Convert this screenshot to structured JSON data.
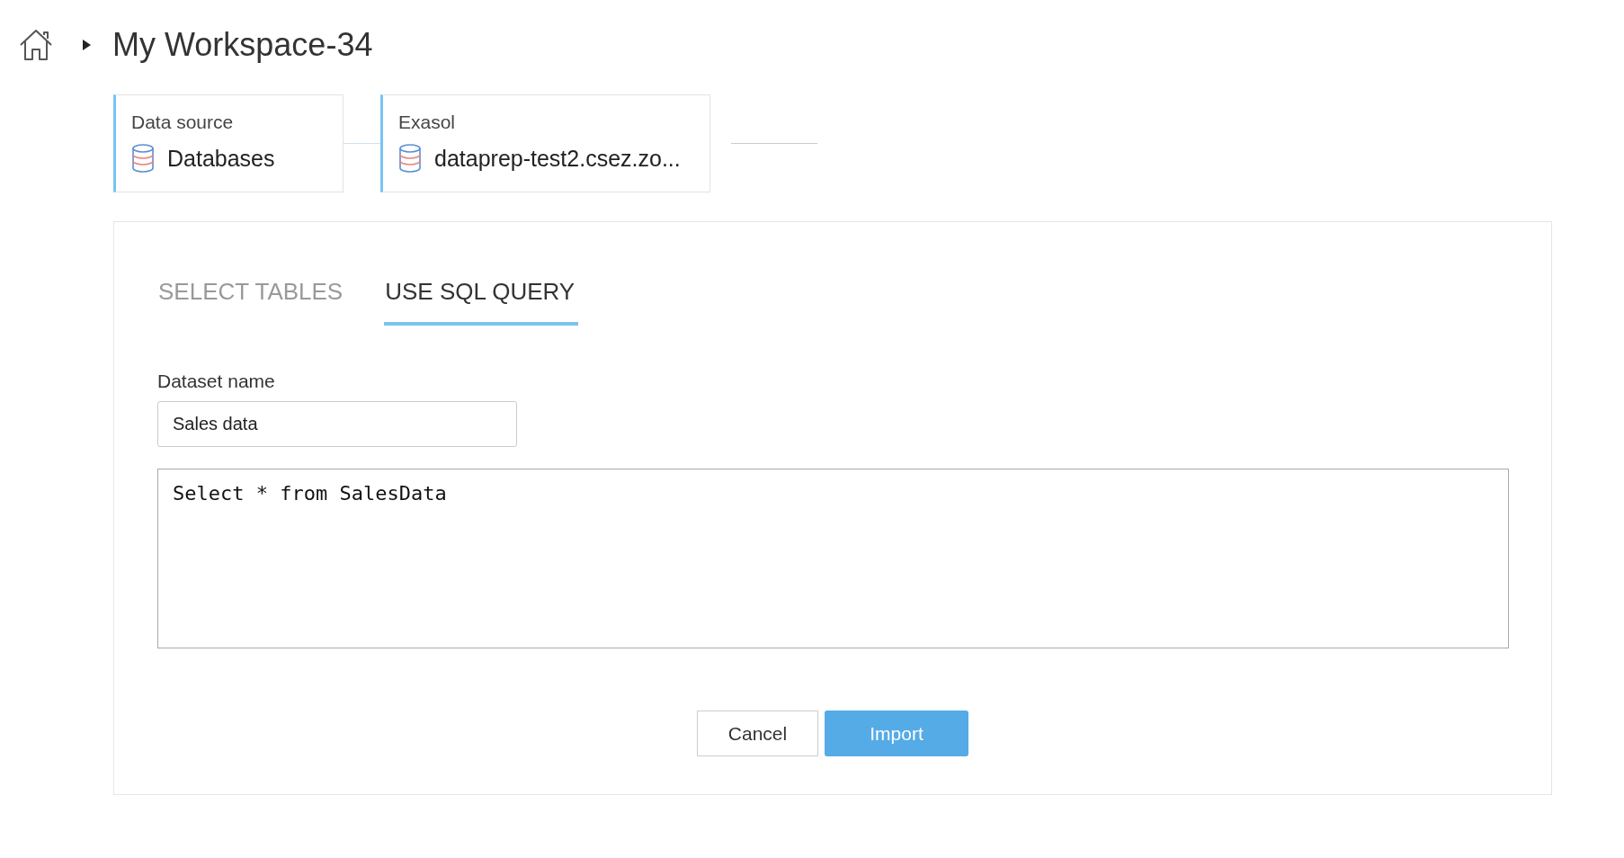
{
  "breadcrumb": {
    "title": "My Workspace-34"
  },
  "steps": [
    {
      "label": "Data source",
      "value": "Databases"
    },
    {
      "label": "Exasol",
      "value": "dataprep-test2.csez.zo..."
    }
  ],
  "tabs": [
    {
      "label": "SELECT TABLES",
      "selected": false
    },
    {
      "label": "USE SQL QUERY",
      "selected": true
    }
  ],
  "dataset_name": {
    "label": "Dataset name",
    "value": "Sales data"
  },
  "query": {
    "value": "Select * from SalesData"
  },
  "buttons": {
    "cancel": "Cancel",
    "import": "Import"
  }
}
